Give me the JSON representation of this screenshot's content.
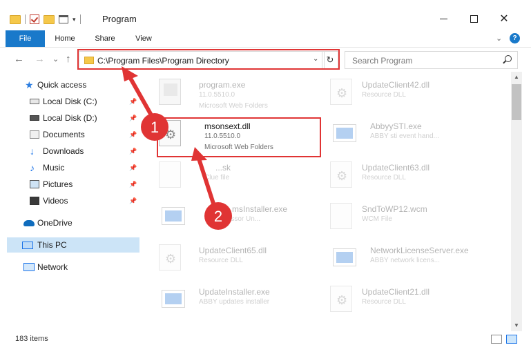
{
  "window": {
    "title": "Program",
    "minimize_glyph": "",
    "maximize_glyph": "",
    "close_glyph": "✕"
  },
  "ribbon": {
    "tabs": [
      {
        "label": "File"
      },
      {
        "label": "Home"
      },
      {
        "label": "Share"
      },
      {
        "label": "View"
      }
    ],
    "help_glyph": "?",
    "collapse_glyph": "⌄"
  },
  "nav": {
    "back_glyph": "←",
    "forward_glyph": "→",
    "recent_glyph": "⌄",
    "up_glyph": "↑",
    "address_path": "C:\\Program Files\\Program Directory",
    "address_dropdown_glyph": "⌄",
    "refresh_glyph": "↻",
    "search_placeholder": "Search Program"
  },
  "sidebar": {
    "items": [
      {
        "label": "Quick access",
        "icon": "star-icon",
        "pinned": false
      },
      {
        "label": "Local Disk (C:)",
        "icon": "drive-icon",
        "pinned": true
      },
      {
        "label": "Local Disk (D:)",
        "icon": "drive-icon",
        "pinned": true
      },
      {
        "label": "Documents",
        "icon": "documents-icon",
        "pinned": true
      },
      {
        "label": "Downloads",
        "icon": "download-icon",
        "pinned": true
      },
      {
        "label": "Music",
        "icon": "music-icon",
        "pinned": true
      },
      {
        "label": "Pictures",
        "icon": "pictures-icon",
        "pinned": true
      },
      {
        "label": "Videos",
        "icon": "videos-icon",
        "pinned": true
      },
      {
        "label": "OneDrive",
        "icon": "cloud-icon",
        "pinned": false
      },
      {
        "label": "This PC",
        "icon": "pc-icon",
        "pinned": false,
        "selected": true
      },
      {
        "label": "Network",
        "icon": "network-icon",
        "pinned": false
      }
    ],
    "pin_glyph": "📌"
  },
  "files": [
    {
      "name": "program.exe",
      "line2": "11.0.5510.0",
      "line3": "Microsoft Web Folders",
      "icon": "wizard-icon",
      "faded": true
    },
    {
      "name": "msonsext.dll",
      "line2": "11.0.5510.0",
      "line3": "Microsoft Web Folders",
      "icon": "dll-icon",
      "faded": false,
      "highlighted": true
    },
    {
      "name": "...sk",
      "line2": "Clue file",
      "line3": "",
      "icon": "document-icon",
      "faded": true
    },
    {
      "name": "...msInstaller.exe",
      "line2": "...ssor Un...",
      "line3": "",
      "icon": "exe-icon",
      "faded": true
    },
    {
      "name": "UpdateClient65.dll",
      "line2": "Resource DLL",
      "line3": "",
      "icon": "dll-icon",
      "faded": true
    },
    {
      "name": "UpdateInstaller.exe",
      "line2": "ABBY updates installer",
      "line3": "",
      "icon": "exe-icon",
      "faded": true
    },
    {
      "name": "UpdateClient42.dll",
      "line2": "Resource DLL",
      "line3": "",
      "icon": "dll-icon",
      "faded": true
    },
    {
      "name": "AbbyySTI.exe",
      "line2": "ABBY sti event hand...",
      "line3": "",
      "icon": "exe-icon",
      "faded": true
    },
    {
      "name": "UpdateClient63.dll",
      "line2": "Resource DLL",
      "line3": "",
      "icon": "dll-icon",
      "faded": true
    },
    {
      "name": "SndToWP12.wcm",
      "line2": "WCM File",
      "line3": "",
      "icon": "document-icon",
      "faded": true
    },
    {
      "name": "NetworkLicenseServer.exe",
      "line2": "ABBY network licens...",
      "line3": "",
      "icon": "exe-icon",
      "faded": true
    },
    {
      "name": "UpdateClient21.dll",
      "line2": "Resource DLL",
      "line3": "",
      "icon": "dll-icon",
      "faded": true
    }
  ],
  "status": {
    "item_count": "183 items"
  },
  "annotations": {
    "marker_1": "1",
    "marker_2": "2",
    "color": "#e03434"
  },
  "colors": {
    "accent": "#1979ca",
    "selection": "#cce4f7",
    "highlight": "#e03434"
  }
}
